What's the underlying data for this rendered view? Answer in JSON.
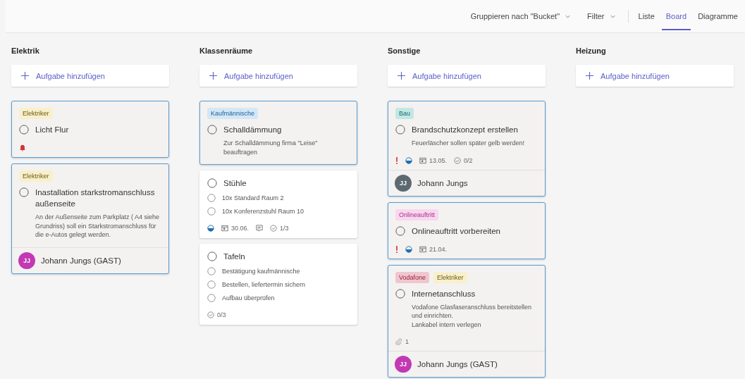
{
  "toolbar": {
    "group_by": "Gruppieren nach \"Bucket\"",
    "filter": "Filter",
    "views": [
      {
        "label": "Liste",
        "selected": false
      },
      {
        "label": "Board",
        "selected": true
      },
      {
        "label": "Diagramme",
        "selected": false
      }
    ]
  },
  "buckets": [
    {
      "name": "Elektrik",
      "add_label": "Aufgabe hinzufügen",
      "cards": [
        {
          "selected": true,
          "labels": [
            {
              "text": "Elektriker",
              "color": "#f8f0cc"
            }
          ],
          "title": "Licht Flur",
          "reminder": true
        },
        {
          "selected": true,
          "labels": [
            {
              "text": "Elektriker",
              "color": "#f8f0cc"
            }
          ],
          "title": "Inastallation starkstromanschluss außenseite",
          "description": "An der Außenseite zum Parkplatz ( A4 siehe Grundriss) soll ein Starkstromanschluss für die e-Autos gelegt werden.",
          "assignee": {
            "initials": "JJ",
            "name": "Johann Jungs (GAST)",
            "color": "#c239b3"
          }
        }
      ]
    },
    {
      "name": "Klassenräume",
      "add_label": "Aufgabe hinzufügen",
      "cards": [
        {
          "selected": true,
          "labels": [
            {
              "text": "Kaufmännische",
              "color": "#d4e7f6"
            }
          ],
          "title": "Schalldämmung",
          "description": "Zur Schalldämmung firma \"Leise\" beauftragen"
        },
        {
          "selected": false,
          "title": "Stühle",
          "checklist": [
            {
              "text": "10x Standard Raum 2",
              "checked": false
            },
            {
              "text": "10x Konferenzstuhl Raum 10",
              "checked": false
            }
          ],
          "in_progress": true,
          "due": "30.06.",
          "comments": true,
          "checklist_count": "1/3"
        },
        {
          "selected": false,
          "title": "Tafeln",
          "checklist": [
            {
              "text": "Bestätigung kaufmännische",
              "checked": false
            },
            {
              "text": "Bestellen, liefertermin sichern",
              "checked": false
            },
            {
              "text": "Aufbau überprüfen",
              "checked": false
            }
          ],
          "checklist_count": "0/3"
        }
      ]
    },
    {
      "name": "Sonstige",
      "add_label": "Aufgabe hinzufügen",
      "cards": [
        {
          "selected": true,
          "labels": [
            {
              "text": "Bau",
              "color": "#c2e7e5"
            }
          ],
          "title": "Brandschutzkonzept erstellen",
          "description": "Feuerläscher sollen später gelb werden!",
          "urgent": true,
          "in_progress": true,
          "due": "13.05.",
          "checklist_count": "0/2",
          "assignee": {
            "initials": "JJ",
            "name": "Johann Jungs",
            "color": "#5c6970"
          }
        },
        {
          "selected": true,
          "labels": [
            {
              "text": "Onlineauftritt",
              "color": "#f9d7ef"
            }
          ],
          "title": "Onlineauftritt vorbereiten",
          "urgent": true,
          "in_progress": true,
          "due": "21.04."
        },
        {
          "selected": true,
          "labels": [
            {
              "text": "Vodafone",
              "color": "#efc6cf"
            },
            {
              "text": "Elektriker",
              "color": "#f8f0cc"
            }
          ],
          "title": "Internetanschluss",
          "description": "Vodafone Glasfaseranschluss bereitstellen\nund einrichten.\nLankabel intern verlegen",
          "attachments": "1",
          "assignee": {
            "initials": "JJ",
            "name": "Johann Jungs (GAST)",
            "color": "#c239b3"
          }
        }
      ]
    },
    {
      "name": "Heizung",
      "add_label": "Aufgabe hinzufügen"
    }
  ]
}
